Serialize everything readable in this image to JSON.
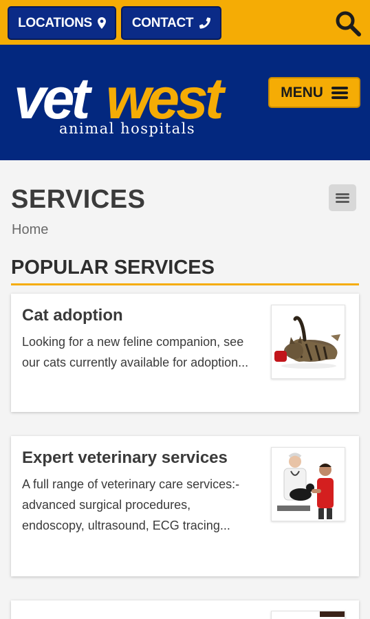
{
  "topbar": {
    "locations_label": "LOCATIONS",
    "contact_label": "CONTACT",
    "icons": [
      "map-pin-icon",
      "phone-icon",
      "search-icon"
    ]
  },
  "header": {
    "logo_primary": "vet",
    "logo_accent": "west",
    "logo_sub": "animal hospitals",
    "menu_label": "MENU"
  },
  "page": {
    "title": "SERVICES",
    "breadcrumb": "Home",
    "section_heading": "POPULAR SERVICES"
  },
  "cards": [
    {
      "title": "Cat adoption",
      "text": "Looking for a new feline companion, see our cats currently available for adoption...",
      "image": "cat-photo"
    },
    {
      "title": "Expert veterinary services",
      "text": "A full range of veterinary care services:- advanced surgical procedures, endoscopy, ultrasound, ECG tracing...",
      "image": "vet-with-boy-and-dog-photo"
    },
    {
      "title": "",
      "text": "",
      "image": "partial-photo"
    }
  ],
  "colors": {
    "accent": "#f5ac05",
    "brand_blue": "#03287f",
    "button_blue": "#0b2b87",
    "background": "#f4f4f4"
  }
}
